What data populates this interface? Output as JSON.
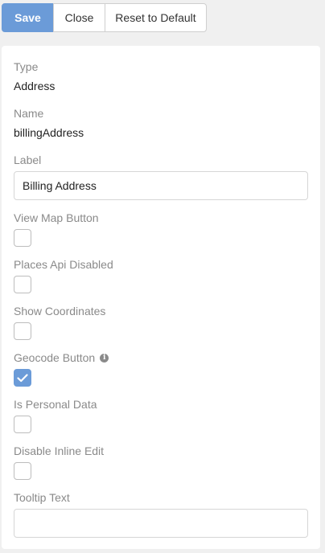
{
  "toolbar": {
    "save_label": "Save",
    "close_label": "Close",
    "reset_label": "Reset to Default"
  },
  "fields": {
    "type": {
      "label": "Type",
      "value": "Address"
    },
    "name": {
      "label": "Name",
      "value": "billingAddress"
    },
    "label": {
      "label": "Label",
      "value": "Billing Address"
    },
    "view_map_button": {
      "label": "View Map Button",
      "checked": false
    },
    "places_api_disabled": {
      "label": "Places Api Disabled",
      "checked": false
    },
    "show_coordinates": {
      "label": "Show Coordinates",
      "checked": false
    },
    "geocode_button": {
      "label": "Geocode Button",
      "checked": true,
      "info_icon": "info-icon"
    },
    "is_personal_data": {
      "label": "Is Personal Data",
      "checked": false
    },
    "disable_inline_edit": {
      "label": "Disable Inline Edit",
      "checked": false
    },
    "tooltip_text": {
      "label": "Tooltip Text",
      "value": ""
    }
  },
  "colors": {
    "primary": "#6b9bd8",
    "label": "#8a8a8a",
    "background": "#f0f0f0",
    "panel": "#ffffff"
  }
}
